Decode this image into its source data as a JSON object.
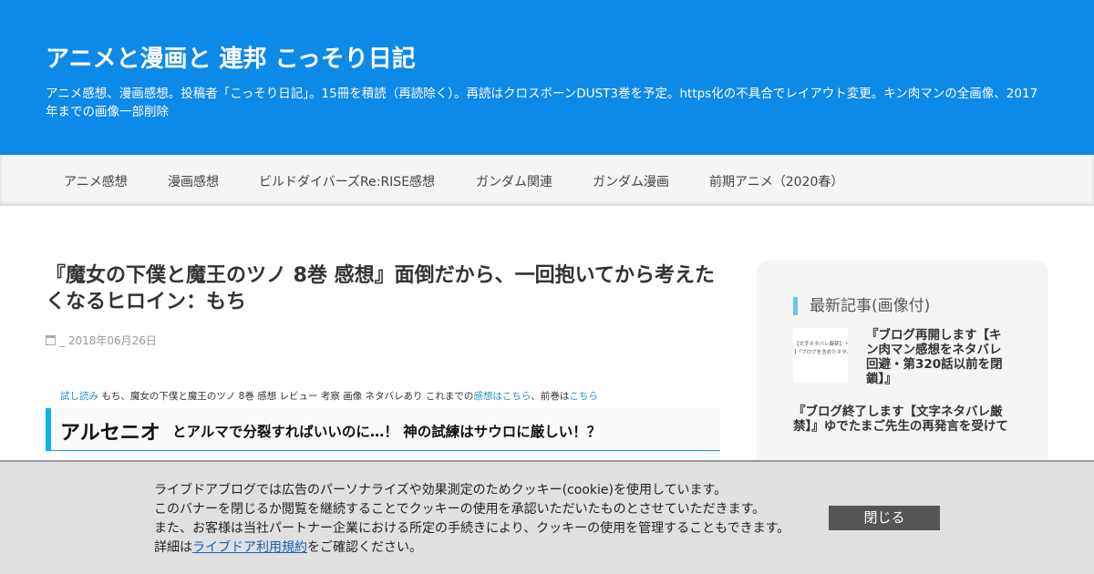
{
  "header": {
    "site_title": "アニメと漫画と 連邦 こっそり日記",
    "description": "アニメ感想、漫画感想。投稿者「こっそり日記」。15冊を積読（再読除く）。再読はクロスボーンDUST3巻を予定。https化の不具合でレイアウト変更。キン肉マンの全画像、2017年までの画像一部削除",
    "bg_color": "#0d8ae8"
  },
  "nav": {
    "items": [
      {
        "label": "アニメ感想"
      },
      {
        "label": "漫画感想"
      },
      {
        "label": "ビルドダイバーズRe:RISE感想"
      },
      {
        "label": "ガンダム関連"
      },
      {
        "label": "ガンダム漫画"
      },
      {
        "label": "前期アニメ（2020春）"
      }
    ]
  },
  "post": {
    "title": "『魔女の下僕と魔王のツノ 8巻 感想』面倒だから、一回抱いてから考えたくなるヒロイン：もち",
    "date_prefix": "_",
    "date": "2018年06月26日",
    "intro": {
      "trial_link": "試し読み",
      "text1": " もち、魔女の下僕と魔王のツノ 8巻 感想 レビュー 考察 画像 ネタバレあり これまでの",
      "thoughts_link": "感想はこちら",
      "text2": "、前巻は",
      "prev_link": "こちら"
    },
    "heading_big": "アルセニオ",
    "heading_small": "とアルマで分裂すればいいのに…！ 神の試練はサウロに厳しい！？",
    "accent_color": "#0bb2e6"
  },
  "sidebar": {
    "title": "最新記事(画像付)",
    "thumb_lines": [
      "【文字ネタバレ厳禁】 ゆでたま",
      "】『ブログを含めたネタバレ厳"
    ],
    "items": [
      {
        "title": "『ブログ再開します【キン肉マン感想をネタバレ回避・第320話以前を閉鎖】』"
      },
      {
        "title": "『ブログ終了します【文字ネタバレ厳禁】』ゆでたまご先生の再発言を受けて"
      }
    ]
  },
  "cookie": {
    "line1": "ライブドアブログでは広告のパーソナライズや効果測定のためクッキー(cookie)を使用しています。",
    "line2": "このバナーを閉じるか閲覧を継続することでクッキーの使用を承認いただいたものとさせていただきます。",
    "line3": "また、お客様は当社パートナー企業における所定の手続きにより、クッキーの使用を管理することもできます。",
    "line4_prefix": "詳細は",
    "line4_link": "ライブドア利用規約",
    "line4_suffix": "をご確認ください。",
    "close_label": "閉じる"
  }
}
